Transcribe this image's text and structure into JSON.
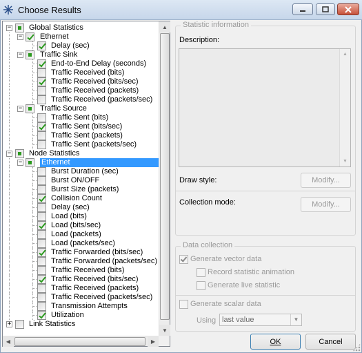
{
  "window": {
    "title": "Choose Results"
  },
  "tree": {
    "rows": [
      {
        "label": "Global Statistics",
        "level": 0,
        "expander": "minus",
        "check": "partial"
      },
      {
        "label": "Ethernet",
        "level": 1,
        "expander": "minus",
        "check": "checked"
      },
      {
        "label": "Delay (sec)",
        "level": 2,
        "expander": null,
        "check": "checked"
      },
      {
        "label": "Traffic Sink",
        "level": 1,
        "expander": "minus",
        "check": "partial"
      },
      {
        "label": "End-to-End Delay (seconds)",
        "level": 2,
        "expander": null,
        "check": "checked"
      },
      {
        "label": "Traffic Received (bits)",
        "level": 2,
        "expander": null,
        "check": "none"
      },
      {
        "label": "Traffic Received (bits/sec)",
        "level": 2,
        "expander": null,
        "check": "checked"
      },
      {
        "label": "Traffic Received (packets)",
        "level": 2,
        "expander": null,
        "check": "none"
      },
      {
        "label": "Traffic Received (packets/sec)",
        "level": 2,
        "expander": null,
        "check": "none"
      },
      {
        "label": "Traffic Source",
        "level": 1,
        "expander": "minus",
        "check": "partial"
      },
      {
        "label": "Traffic Sent (bits)",
        "level": 2,
        "expander": null,
        "check": "none"
      },
      {
        "label": "Traffic Sent (bits/sec)",
        "level": 2,
        "expander": null,
        "check": "checked"
      },
      {
        "label": "Traffic Sent (packets)",
        "level": 2,
        "expander": null,
        "check": "none"
      },
      {
        "label": "Traffic Sent (packets/sec)",
        "level": 2,
        "expander": null,
        "check": "none"
      },
      {
        "label": "Node Statistics",
        "level": 0,
        "expander": "minus",
        "check": "partial"
      },
      {
        "label": "Ethernet",
        "level": 1,
        "expander": "minus",
        "check": "partial",
        "selected": true
      },
      {
        "label": "Burst Duration (sec)",
        "level": 2,
        "expander": null,
        "check": "none"
      },
      {
        "label": "Burst ON/OFF",
        "level": 2,
        "expander": null,
        "check": "none"
      },
      {
        "label": "Burst Size (packets)",
        "level": 2,
        "expander": null,
        "check": "none"
      },
      {
        "label": "Collision Count",
        "level": 2,
        "expander": null,
        "check": "checked"
      },
      {
        "label": "Delay (sec)",
        "level": 2,
        "expander": null,
        "check": "none"
      },
      {
        "label": "Load (bits)",
        "level": 2,
        "expander": null,
        "check": "none"
      },
      {
        "label": "Load (bits/sec)",
        "level": 2,
        "expander": null,
        "check": "checked"
      },
      {
        "label": "Load (packets)",
        "level": 2,
        "expander": null,
        "check": "none"
      },
      {
        "label": "Load (packets/sec)",
        "level": 2,
        "expander": null,
        "check": "none"
      },
      {
        "label": "Traffic Forwarded (bits/sec)",
        "level": 2,
        "expander": null,
        "check": "checked"
      },
      {
        "label": "Traffic Forwarded (packets/sec)",
        "level": 2,
        "expander": null,
        "check": "none"
      },
      {
        "label": "Traffic Received (bits)",
        "level": 2,
        "expander": null,
        "check": "none"
      },
      {
        "label": "Traffic Received (bits/sec)",
        "level": 2,
        "expander": null,
        "check": "checked"
      },
      {
        "label": "Traffic Received (packets)",
        "level": 2,
        "expander": null,
        "check": "none"
      },
      {
        "label": "Traffic Received (packets/sec)",
        "level": 2,
        "expander": null,
        "check": "none"
      },
      {
        "label": "Transmission Attempts",
        "level": 2,
        "expander": null,
        "check": "none"
      },
      {
        "label": "Utilization",
        "level": 2,
        "expander": null,
        "check": "checked"
      },
      {
        "label": "Link Statistics",
        "level": 0,
        "expander": "plus",
        "check": "none"
      }
    ]
  },
  "statistic_info": {
    "title": "Statistic information",
    "description_label": "Description:",
    "draw_style_label": "Draw style:",
    "modify_label": "Modify...",
    "collection_mode_label": "Collection mode:"
  },
  "data_collection": {
    "title": "Data collection",
    "generate_vector": "Generate vector data",
    "record_animation": "Record statistic animation",
    "generate_live": "Generate live statistic",
    "generate_scalar": "Generate scalar data",
    "using_label": "Using",
    "using_value": "last value"
  },
  "buttons": {
    "ok": "OK",
    "cancel": "Cancel"
  },
  "colors": {
    "selection": "#3399ff",
    "check": "#2b9a1e"
  }
}
